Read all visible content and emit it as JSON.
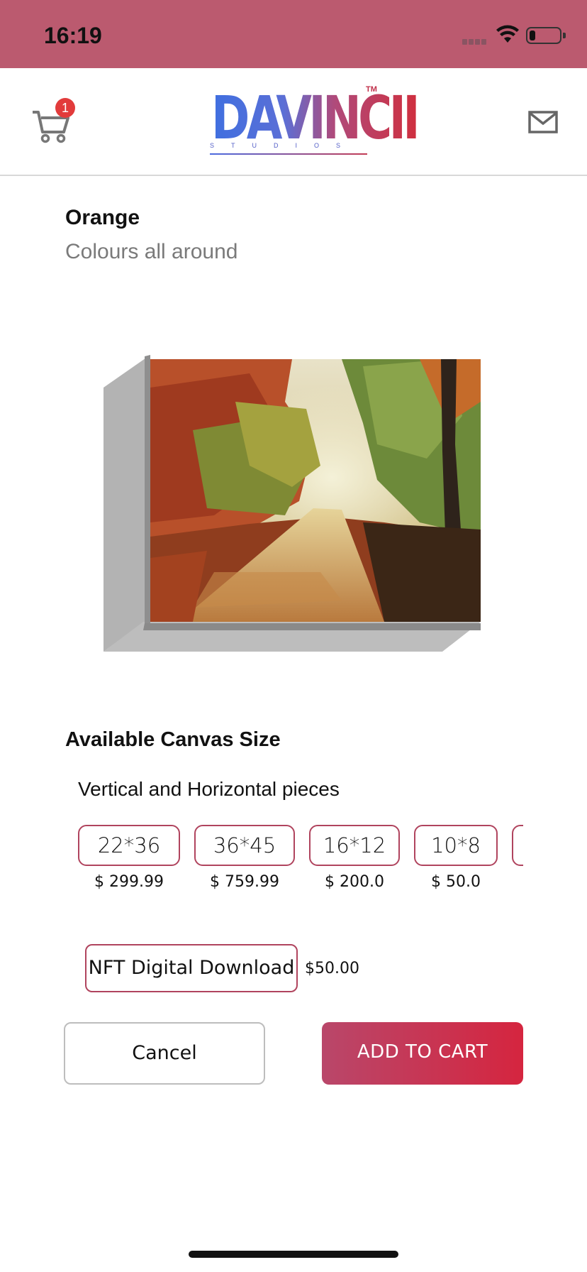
{
  "status_bar": {
    "time": "16:19",
    "icons": [
      "cellular-signal-icon",
      "wifi-icon",
      "battery-icon"
    ],
    "background": "#bb5a6f"
  },
  "header": {
    "cart_badge": "1",
    "logo_text": "DAVINCII",
    "logo_tm": "TM",
    "logo_subtitle": "STUDIOS",
    "cart_icon": "cart-icon",
    "mail_icon": "mail-icon"
  },
  "product": {
    "title": "Orange",
    "subtitle": "Colours all around",
    "image": "autumn forest road canvas preview"
  },
  "canvas_sizes": {
    "heading": "Available Canvas Size",
    "subheading": "Vertical and Horizontal pieces",
    "options": [
      {
        "size": "22*36",
        "price": "$ 299.99"
      },
      {
        "size": "36*45",
        "price": "$ 759.99"
      },
      {
        "size": "16*12",
        "price": "$ 200.0"
      },
      {
        "size": "10*8",
        "price": "$ 50.0"
      }
    ]
  },
  "nft": {
    "label": "NFT Digital Download",
    "price": "$50.00"
  },
  "actions": {
    "cancel": "Cancel",
    "add_to_cart": "ADD TO CART"
  },
  "colors": {
    "accent": "#b0445e",
    "button_gradient_start": "#b9476a",
    "button_gradient_end": "#d5253f"
  }
}
